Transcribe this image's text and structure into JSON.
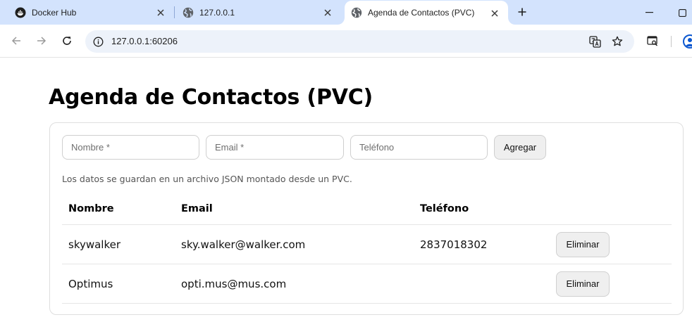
{
  "browser": {
    "tabs": [
      {
        "title": "Docker Hub",
        "icon": "docker-icon",
        "active": false
      },
      {
        "title": "127.0.0.1",
        "icon": "globe-icon",
        "active": false
      },
      {
        "title": "Agenda de Contactos (PVC)",
        "icon": "globe-icon",
        "active": true
      }
    ],
    "url": "127.0.0.1:60206",
    "colors": {
      "tabstrip": "#d3e3fd",
      "omnibox": "#edf2fa",
      "accent": "#0b57d0"
    }
  },
  "page": {
    "title": "Agenda de Contactos (PVC)",
    "form": {
      "name_placeholder": "Nombre *",
      "email_placeholder": "Email *",
      "phone_placeholder": "Teléfono",
      "submit_label": "Agregar"
    },
    "hint": "Los datos se guardan en un archivo JSON montado desde un PVC.",
    "table": {
      "headers": [
        "Nombre",
        "Email",
        "Teléfono"
      ],
      "rows": [
        {
          "name": "skywalker",
          "email": "sky.walker@walker.com",
          "phone": "2837018302",
          "action": "Eliminar"
        },
        {
          "name": "Optimus",
          "email": "opti.mus@mus.com",
          "phone": "",
          "action": "Eliminar"
        }
      ]
    }
  }
}
